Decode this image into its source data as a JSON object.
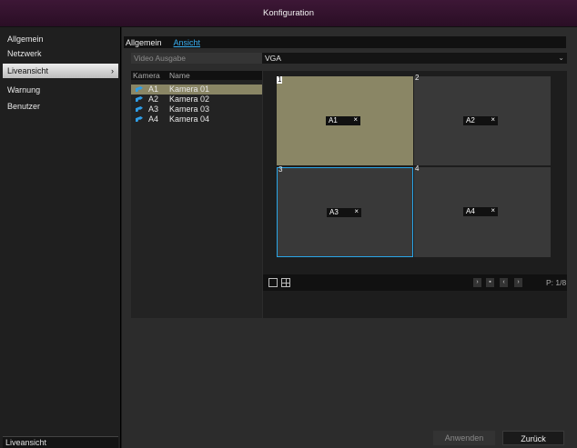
{
  "window": {
    "title": "Konfiguration"
  },
  "sidebar": {
    "items": [
      {
        "label": "Allgemein"
      },
      {
        "label": "Netzwerk"
      },
      {
        "label": "Liveansicht",
        "active": true,
        "chevron": "›"
      },
      {
        "label": "Warnung"
      },
      {
        "label": "Benutzer"
      }
    ],
    "footer": "Liveansicht"
  },
  "tabs": [
    {
      "label": "Allgemein"
    },
    {
      "label": "Ansicht",
      "active": true
    }
  ],
  "video_output": {
    "label": "Video Ausgabe",
    "value": "VGA",
    "chevron": "⌄"
  },
  "camera_list": {
    "headers": {
      "camera": "Kamera",
      "name": "Name"
    },
    "rows": [
      {
        "id": "A1",
        "name": "Kamera 01",
        "selected": true
      },
      {
        "id": "A2",
        "name": "Kamera 02"
      },
      {
        "id": "A3",
        "name": "Kamera 03"
      },
      {
        "id": "A4",
        "name": "Kamera 04"
      }
    ]
  },
  "layout": {
    "tiles": [
      {
        "number": "1",
        "label": "A1",
        "close": "×"
      },
      {
        "number": "2",
        "label": "A2",
        "close": "×"
      },
      {
        "number": "3",
        "label": "A3",
        "close": "×"
      },
      {
        "number": "4",
        "label": "A4",
        "close": "×"
      }
    ],
    "nav": {
      "next": "›",
      "stop": "▪",
      "prev": "‹",
      "last": "›"
    },
    "page": "P: 1/8"
  },
  "buttons": {
    "apply": "Anwenden",
    "back": "Zurück"
  },
  "colors": {
    "accent": "#2aa6e8",
    "titlebar": "#3d1736",
    "selected": "#8a8665"
  }
}
